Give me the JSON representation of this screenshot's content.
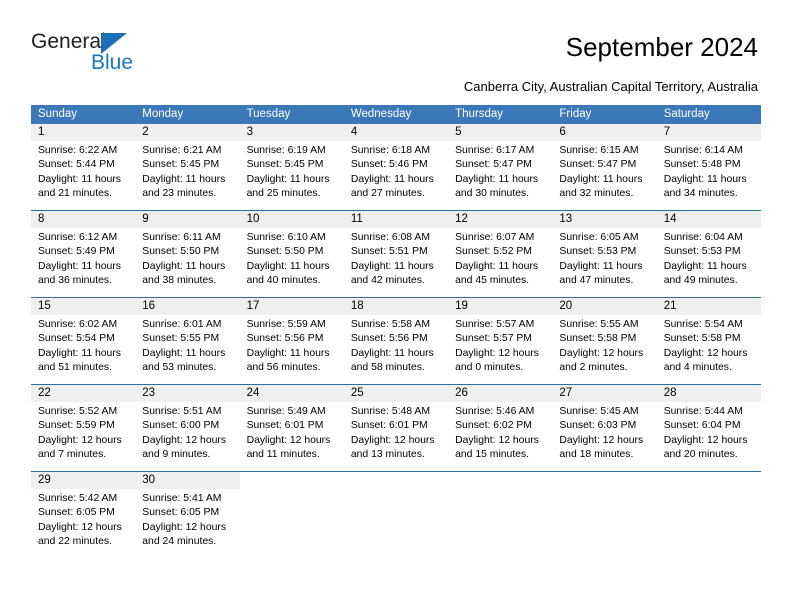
{
  "brand": {
    "name_part1": "General",
    "name_part2": "Blue",
    "triangle_color": "#1a6fb5",
    "blue_color": "#1a78c2"
  },
  "header": {
    "title": "September 2024",
    "subtitle": "Canberra City, Australian Capital Territory, Australia"
  },
  "theme": {
    "header_bg": "#3a78b8",
    "header_text": "#ffffff",
    "daynum_bg": "#efefef",
    "week_divider": "#2e6da8"
  },
  "calendar": {
    "weekday_headers": [
      "Sunday",
      "Monday",
      "Tuesday",
      "Wednesday",
      "Thursday",
      "Friday",
      "Saturday"
    ],
    "weeks": [
      {
        "days": [
          {
            "num": "1",
            "sunrise": "Sunrise: 6:22 AM",
            "sunset": "Sunset: 5:44 PM",
            "daylight": "Daylight: 11 hours and 21 minutes."
          },
          {
            "num": "2",
            "sunrise": "Sunrise: 6:21 AM",
            "sunset": "Sunset: 5:45 PM",
            "daylight": "Daylight: 11 hours and 23 minutes."
          },
          {
            "num": "3",
            "sunrise": "Sunrise: 6:19 AM",
            "sunset": "Sunset: 5:45 PM",
            "daylight": "Daylight: 11 hours and 25 minutes."
          },
          {
            "num": "4",
            "sunrise": "Sunrise: 6:18 AM",
            "sunset": "Sunset: 5:46 PM",
            "daylight": "Daylight: 11 hours and 27 minutes."
          },
          {
            "num": "5",
            "sunrise": "Sunrise: 6:17 AM",
            "sunset": "Sunset: 5:47 PM",
            "daylight": "Daylight: 11 hours and 30 minutes."
          },
          {
            "num": "6",
            "sunrise": "Sunrise: 6:15 AM",
            "sunset": "Sunset: 5:47 PM",
            "daylight": "Daylight: 11 hours and 32 minutes."
          },
          {
            "num": "7",
            "sunrise": "Sunrise: 6:14 AM",
            "sunset": "Sunset: 5:48 PM",
            "daylight": "Daylight: 11 hours and 34 minutes."
          }
        ]
      },
      {
        "days": [
          {
            "num": "8",
            "sunrise": "Sunrise: 6:12 AM",
            "sunset": "Sunset: 5:49 PM",
            "daylight": "Daylight: 11 hours and 36 minutes."
          },
          {
            "num": "9",
            "sunrise": "Sunrise: 6:11 AM",
            "sunset": "Sunset: 5:50 PM",
            "daylight": "Daylight: 11 hours and 38 minutes."
          },
          {
            "num": "10",
            "sunrise": "Sunrise: 6:10 AM",
            "sunset": "Sunset: 5:50 PM",
            "daylight": "Daylight: 11 hours and 40 minutes."
          },
          {
            "num": "11",
            "sunrise": "Sunrise: 6:08 AM",
            "sunset": "Sunset: 5:51 PM",
            "daylight": "Daylight: 11 hours and 42 minutes."
          },
          {
            "num": "12",
            "sunrise": "Sunrise: 6:07 AM",
            "sunset": "Sunset: 5:52 PM",
            "daylight": "Daylight: 11 hours and 45 minutes."
          },
          {
            "num": "13",
            "sunrise": "Sunrise: 6:05 AM",
            "sunset": "Sunset: 5:53 PM",
            "daylight": "Daylight: 11 hours and 47 minutes."
          },
          {
            "num": "14",
            "sunrise": "Sunrise: 6:04 AM",
            "sunset": "Sunset: 5:53 PM",
            "daylight": "Daylight: 11 hours and 49 minutes."
          }
        ]
      },
      {
        "days": [
          {
            "num": "15",
            "sunrise": "Sunrise: 6:02 AM",
            "sunset": "Sunset: 5:54 PM",
            "daylight": "Daylight: 11 hours and 51 minutes."
          },
          {
            "num": "16",
            "sunrise": "Sunrise: 6:01 AM",
            "sunset": "Sunset: 5:55 PM",
            "daylight": "Daylight: 11 hours and 53 minutes."
          },
          {
            "num": "17",
            "sunrise": "Sunrise: 5:59 AM",
            "sunset": "Sunset: 5:56 PM",
            "daylight": "Daylight: 11 hours and 56 minutes."
          },
          {
            "num": "18",
            "sunrise": "Sunrise: 5:58 AM",
            "sunset": "Sunset: 5:56 PM",
            "daylight": "Daylight: 11 hours and 58 minutes."
          },
          {
            "num": "19",
            "sunrise": "Sunrise: 5:57 AM",
            "sunset": "Sunset: 5:57 PM",
            "daylight": "Daylight: 12 hours and 0 minutes."
          },
          {
            "num": "20",
            "sunrise": "Sunrise: 5:55 AM",
            "sunset": "Sunset: 5:58 PM",
            "daylight": "Daylight: 12 hours and 2 minutes."
          },
          {
            "num": "21",
            "sunrise": "Sunrise: 5:54 AM",
            "sunset": "Sunset: 5:58 PM",
            "daylight": "Daylight: 12 hours and 4 minutes."
          }
        ]
      },
      {
        "days": [
          {
            "num": "22",
            "sunrise": "Sunrise: 5:52 AM",
            "sunset": "Sunset: 5:59 PM",
            "daylight": "Daylight: 12 hours and 7 minutes."
          },
          {
            "num": "23",
            "sunrise": "Sunrise: 5:51 AM",
            "sunset": "Sunset: 6:00 PM",
            "daylight": "Daylight: 12 hours and 9 minutes."
          },
          {
            "num": "24",
            "sunrise": "Sunrise: 5:49 AM",
            "sunset": "Sunset: 6:01 PM",
            "daylight": "Daylight: 12 hours and 11 minutes."
          },
          {
            "num": "25",
            "sunrise": "Sunrise: 5:48 AM",
            "sunset": "Sunset: 6:01 PM",
            "daylight": "Daylight: 12 hours and 13 minutes."
          },
          {
            "num": "26",
            "sunrise": "Sunrise: 5:46 AM",
            "sunset": "Sunset: 6:02 PM",
            "daylight": "Daylight: 12 hours and 15 minutes."
          },
          {
            "num": "27",
            "sunrise": "Sunrise: 5:45 AM",
            "sunset": "Sunset: 6:03 PM",
            "daylight": "Daylight: 12 hours and 18 minutes."
          },
          {
            "num": "28",
            "sunrise": "Sunrise: 5:44 AM",
            "sunset": "Sunset: 6:04 PM",
            "daylight": "Daylight: 12 hours and 20 minutes."
          }
        ]
      },
      {
        "days": [
          {
            "num": "29",
            "sunrise": "Sunrise: 5:42 AM",
            "sunset": "Sunset: 6:05 PM",
            "daylight": "Daylight: 12 hours and 22 minutes."
          },
          {
            "num": "30",
            "sunrise": "Sunrise: 5:41 AM",
            "sunset": "Sunset: 6:05 PM",
            "daylight": "Daylight: 12 hours and 24 minutes."
          },
          {
            "num": "",
            "sunrise": "",
            "sunset": "",
            "daylight": ""
          },
          {
            "num": "",
            "sunrise": "",
            "sunset": "",
            "daylight": ""
          },
          {
            "num": "",
            "sunrise": "",
            "sunset": "",
            "daylight": ""
          },
          {
            "num": "",
            "sunrise": "",
            "sunset": "",
            "daylight": ""
          },
          {
            "num": "",
            "sunrise": "",
            "sunset": "",
            "daylight": ""
          }
        ]
      }
    ]
  }
}
